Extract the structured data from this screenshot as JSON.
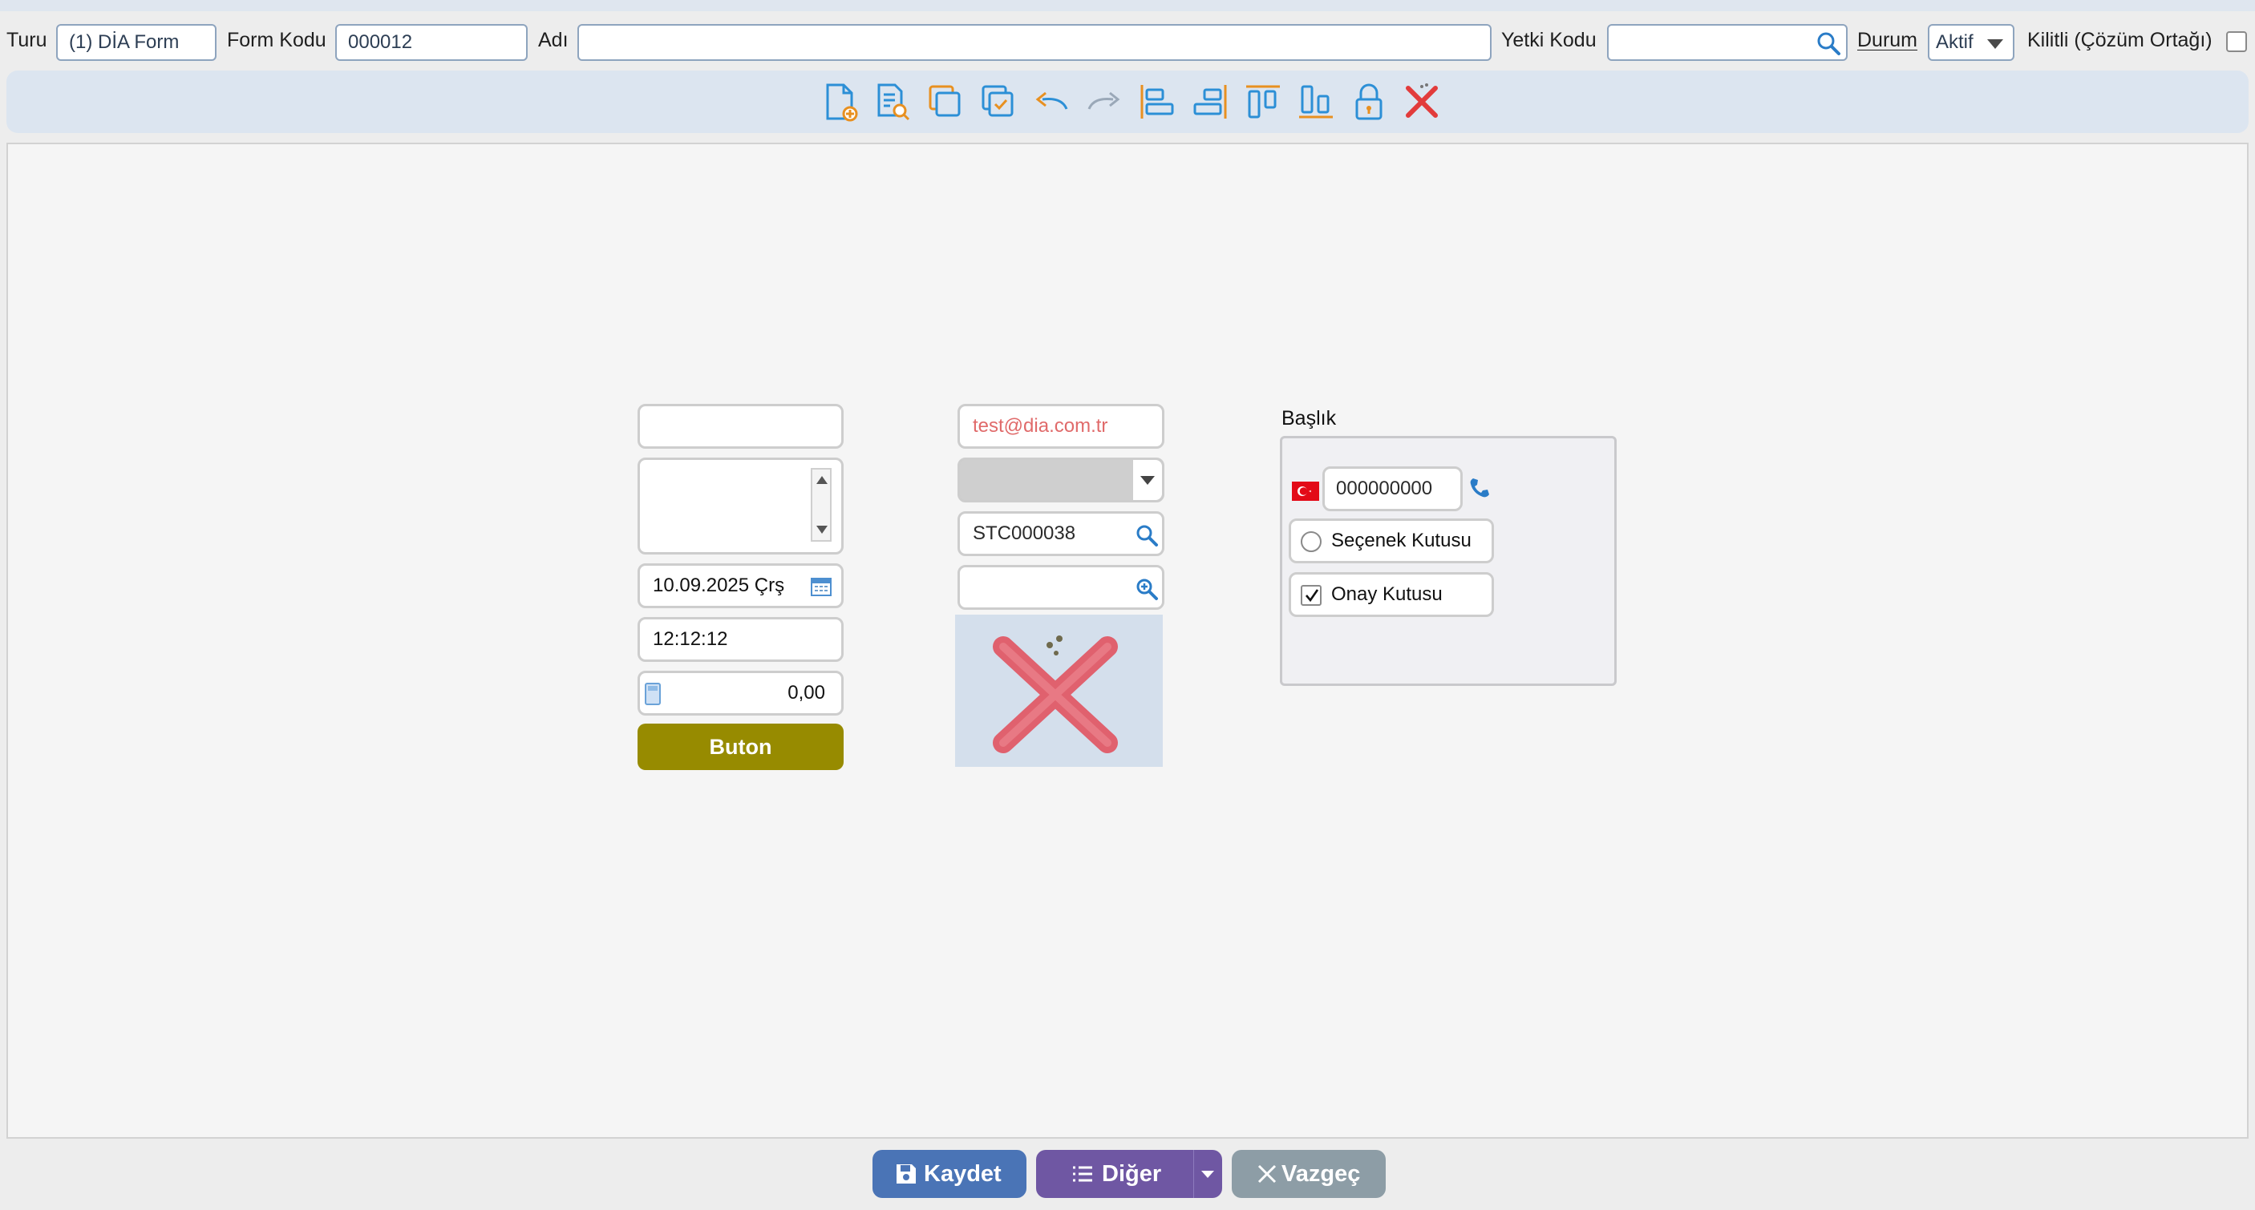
{
  "header": {
    "turu_label": "Turu",
    "turu_value": "(1) DİA Form",
    "form_kodu_label": "Form Kodu",
    "form_kodu_value": "000012",
    "adi_label": "Adı",
    "adi_value": "",
    "yetki_kodu_label": "Yetki Kodu",
    "yetki_kodu_value": "",
    "durum_label": "Durum",
    "durum_value": "Aktif",
    "kilitli_label": "Kilitli (Çözüm Ortağı)"
  },
  "toolbar": {
    "icons": [
      "new-document-icon",
      "preview-document-icon",
      "copy-icon",
      "paste-icon",
      "undo-icon",
      "redo-icon",
      "align-left-icon",
      "align-right-icon",
      "align-top-icon",
      "align-bottom-icon",
      "lock-icon",
      "delete-icon"
    ]
  },
  "canvas": {
    "date_value": "10.09.2025 Çrş",
    "time_value": "12:12:12",
    "number_value": "0,00",
    "button_label": "Buton",
    "email_value": "test@dia.com.tr",
    "lookup_value": "STC000038",
    "group_title": "Başlık",
    "phone_value": "000000000",
    "radio_label": "Seçenek Kutusu",
    "checkbox_label": "Onay Kutusu",
    "checkbox_checked": true
  },
  "footer": {
    "save_label": "Kaydet",
    "other_label": "Diğer",
    "cancel_label": "Vazgeç"
  },
  "colors": {
    "save": "#4a74b6",
    "other": "#6f57a3",
    "cancel": "#8d9da6",
    "olive_button": "#978b00"
  }
}
